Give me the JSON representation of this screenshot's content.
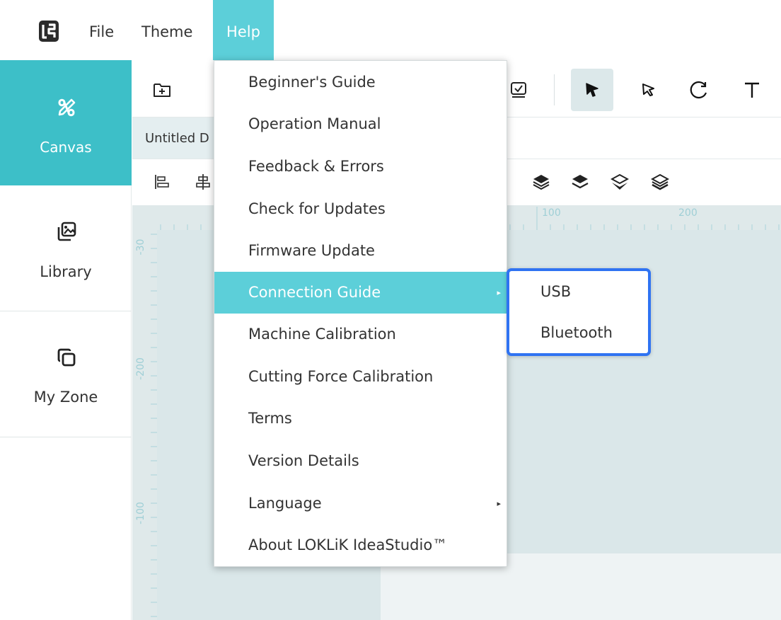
{
  "menubar": {
    "items": [
      {
        "label": "File"
      },
      {
        "label": "Theme"
      },
      {
        "label": "Help"
      }
    ],
    "active": "Help",
    "accent_color": "#5ccfd9"
  },
  "sidebar": {
    "items": [
      {
        "label": "Canvas",
        "icon": "canvas-icon",
        "selected": true
      },
      {
        "label": "Library",
        "icon": "library-icon"
      },
      {
        "label": "My Zone",
        "icon": "my-zone-icon"
      }
    ],
    "selected_color": "#3dbfc8"
  },
  "toolbar": {
    "icons": [
      "add-folder-icon",
      "checkbox-image-icon",
      "select-arrow-icon",
      "node-select-icon",
      "rotate-icon",
      "text-icon"
    ],
    "active": "select-arrow-icon"
  },
  "document": {
    "tab_label": "Untitled D"
  },
  "ruler": {
    "top_labels": [
      "100",
      "200"
    ],
    "side_labels": [
      "-30",
      "-200",
      "-100"
    ]
  },
  "help_menu": {
    "items": [
      {
        "label": "Beginner's Guide"
      },
      {
        "label": "Operation Manual"
      },
      {
        "label": "Feedback & Errors"
      },
      {
        "label": "Check for Updates"
      },
      {
        "label": "Firmware Update"
      },
      {
        "label": "Connection Guide",
        "has_submenu": true,
        "highlighted": true
      },
      {
        "label": "Machine Calibration"
      },
      {
        "label": "Cutting Force Calibration"
      },
      {
        "label": "Terms"
      },
      {
        "label": "Version Details"
      },
      {
        "label": "Language",
        "has_submenu": true
      },
      {
        "label": "About LOKLiK IdeaStudio™"
      }
    ],
    "submenu_arrow": "▸"
  },
  "connection_submenu": {
    "items": [
      {
        "label": "USB"
      },
      {
        "label": "Bluetooth"
      }
    ],
    "border_color": "#2f73f2"
  }
}
